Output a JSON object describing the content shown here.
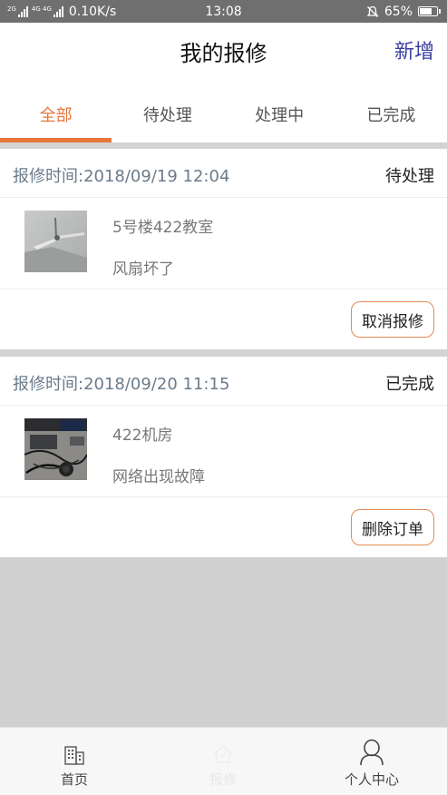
{
  "status_bar": {
    "net_tag_1": "2G",
    "net_tag_2": "4G 4G",
    "speed": "0.10K/s",
    "time": "13:08",
    "battery": "65%",
    "battery_level": 0.65
  },
  "header": {
    "title": "我的报修",
    "add_label": "新增"
  },
  "tabs": [
    {
      "label": "全部",
      "active": true
    },
    {
      "label": "待处理",
      "active": false
    },
    {
      "label": "处理中",
      "active": false
    },
    {
      "label": "已完成",
      "active": false
    }
  ],
  "orders": [
    {
      "time": "报修时间:2018/09/19 12:04",
      "status": "待处理",
      "location": "5号楼422教室",
      "description": "风扇坏了",
      "action": "取消报修",
      "thumbnail": "ceiling-fan-photo"
    },
    {
      "time": "报修时间:2018/09/20 11:15",
      "status": "已完成",
      "location": "422机房",
      "description": "网络出现故障",
      "action": "删除订单",
      "thumbnail": "computer-cables-photo"
    }
  ],
  "bottom_nav": [
    {
      "label": "首页",
      "icon": "building-icon"
    },
    {
      "label": "报修",
      "icon": "repair-icon"
    },
    {
      "label": "个人中心",
      "icon": "user-icon"
    }
  ],
  "colors": {
    "accent": "#e8763a",
    "add_link": "#3a3fa0",
    "time_text": "#6b7b8a"
  }
}
